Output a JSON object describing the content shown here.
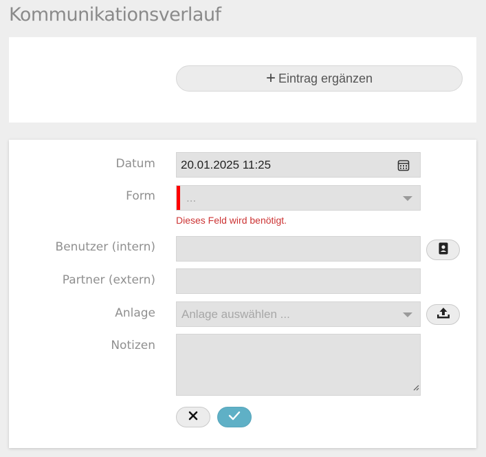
{
  "page": {
    "title": "Kommunikationsverlauf"
  },
  "toolbar": {
    "add_entry_label": "Eintrag ergänzen"
  },
  "form": {
    "date": {
      "label": "Datum",
      "value": "20.01.2025 11:25"
    },
    "form_type": {
      "label": "Form",
      "value": "...",
      "error": "Dieses Feld wird benötigt."
    },
    "internal_user": {
      "label": "Benutzer (intern)",
      "value": ""
    },
    "external_partner": {
      "label": "Partner (extern)",
      "value": ""
    },
    "attachment": {
      "label": "Anlage",
      "placeholder": "Anlage auswählen ..."
    },
    "notes": {
      "label": "Notizen",
      "value": ""
    }
  },
  "colors": {
    "error": "#ff0000",
    "confirm": "#5fb0c6",
    "accent_text": "#cc3333"
  },
  "icons": [
    "plus-icon",
    "calendar-icon",
    "chevron-down-icon",
    "contact-card-icon",
    "upload-icon",
    "resize-handle-icon",
    "close-icon",
    "check-icon"
  ]
}
